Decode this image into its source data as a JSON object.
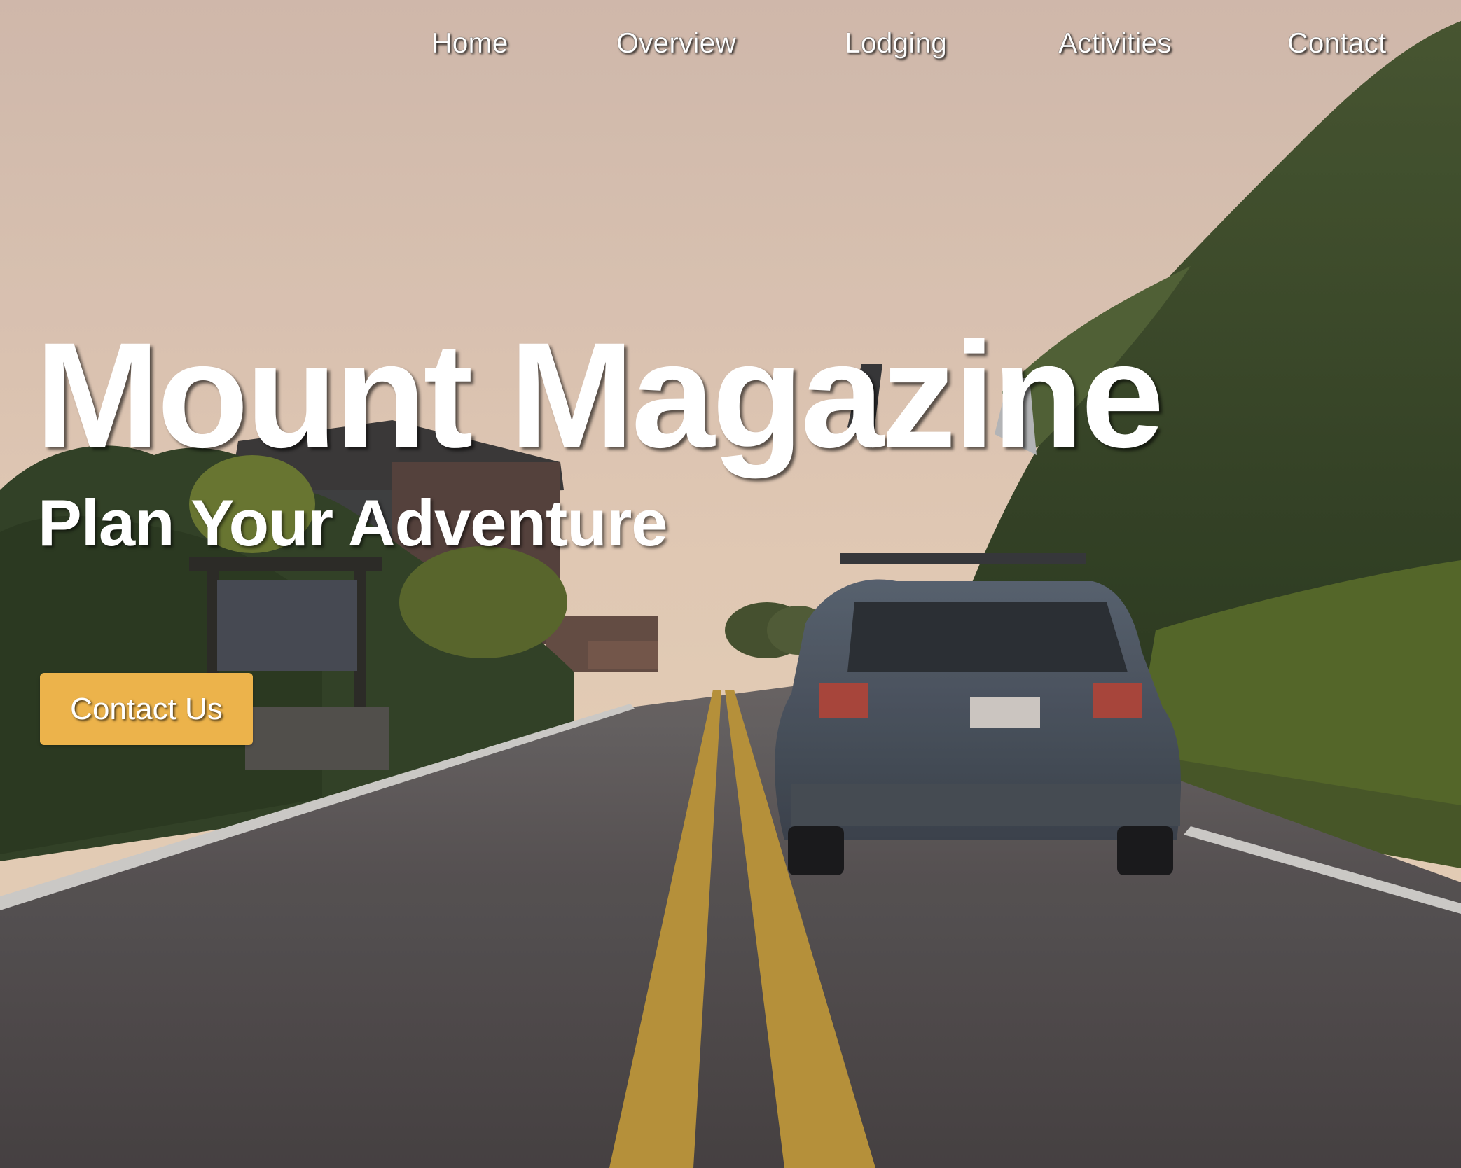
{
  "nav": {
    "items": [
      {
        "label": "Home"
      },
      {
        "label": "Overview"
      },
      {
        "label": "Lodging"
      },
      {
        "label": "Activities"
      },
      {
        "label": "Contact"
      }
    ]
  },
  "hero": {
    "title": "Mount Magazine",
    "subtitle": "Plan Your Adventure",
    "cta_label": "Contact Us",
    "background": "photo of a car with a bike rack driving up a mountain road at dusk"
  },
  "colors": {
    "cta_button": "#ecb34b",
    "text": "#ffffff",
    "sky": "#ecd0b8"
  }
}
